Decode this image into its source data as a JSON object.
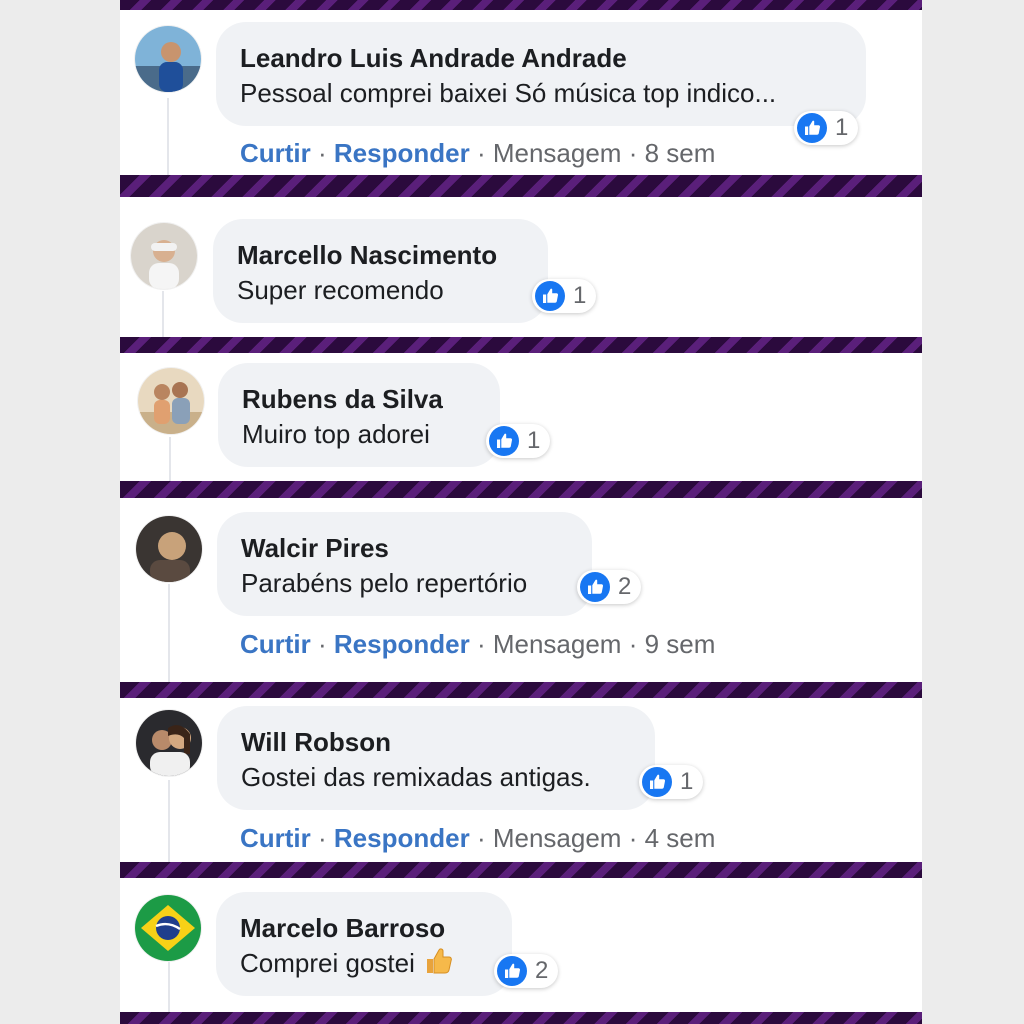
{
  "comments": [
    {
      "author": "Leandro Luis Andrade Andrade",
      "text": "Pessoal comprei baixei Só música top indico...",
      "like_count": "1",
      "actions": {
        "like": "Curtir",
        "reply": "Responder",
        "message": "Mensagem",
        "time": "8 sem"
      }
    },
    {
      "author": "Marcello Nascimento",
      "text": "Super recomendo",
      "like_count": "1"
    },
    {
      "author": "Rubens da Silva",
      "text": "Muiro top adorei",
      "like_count": "1"
    },
    {
      "author": "Walcir Pires",
      "text": "Parabéns pelo repertório",
      "like_count": "2",
      "actions": {
        "like": "Curtir",
        "reply": "Responder",
        "message": "Mensagem",
        "time": "9 sem"
      }
    },
    {
      "author": "Will Robson",
      "text": "Gostei das remixadas antigas.",
      "like_count": "1",
      "actions": {
        "like": "Curtir",
        "reply": "Responder",
        "message": "Mensagem",
        "time": "4 sem"
      }
    },
    {
      "author": "Marcelo Barroso",
      "text": "Comprei gostei",
      "emoji": "thumbs-up-emoji",
      "like_count": "2"
    }
  ],
  "separator": "·",
  "colors": {
    "divider_dark": "#2b0a3d",
    "divider_stripe": "#5a1f7a",
    "bubble": "#f0f2f5",
    "action_link": "#3a75c4",
    "like_blue": "#1877f2",
    "meta_text": "#65676b"
  }
}
